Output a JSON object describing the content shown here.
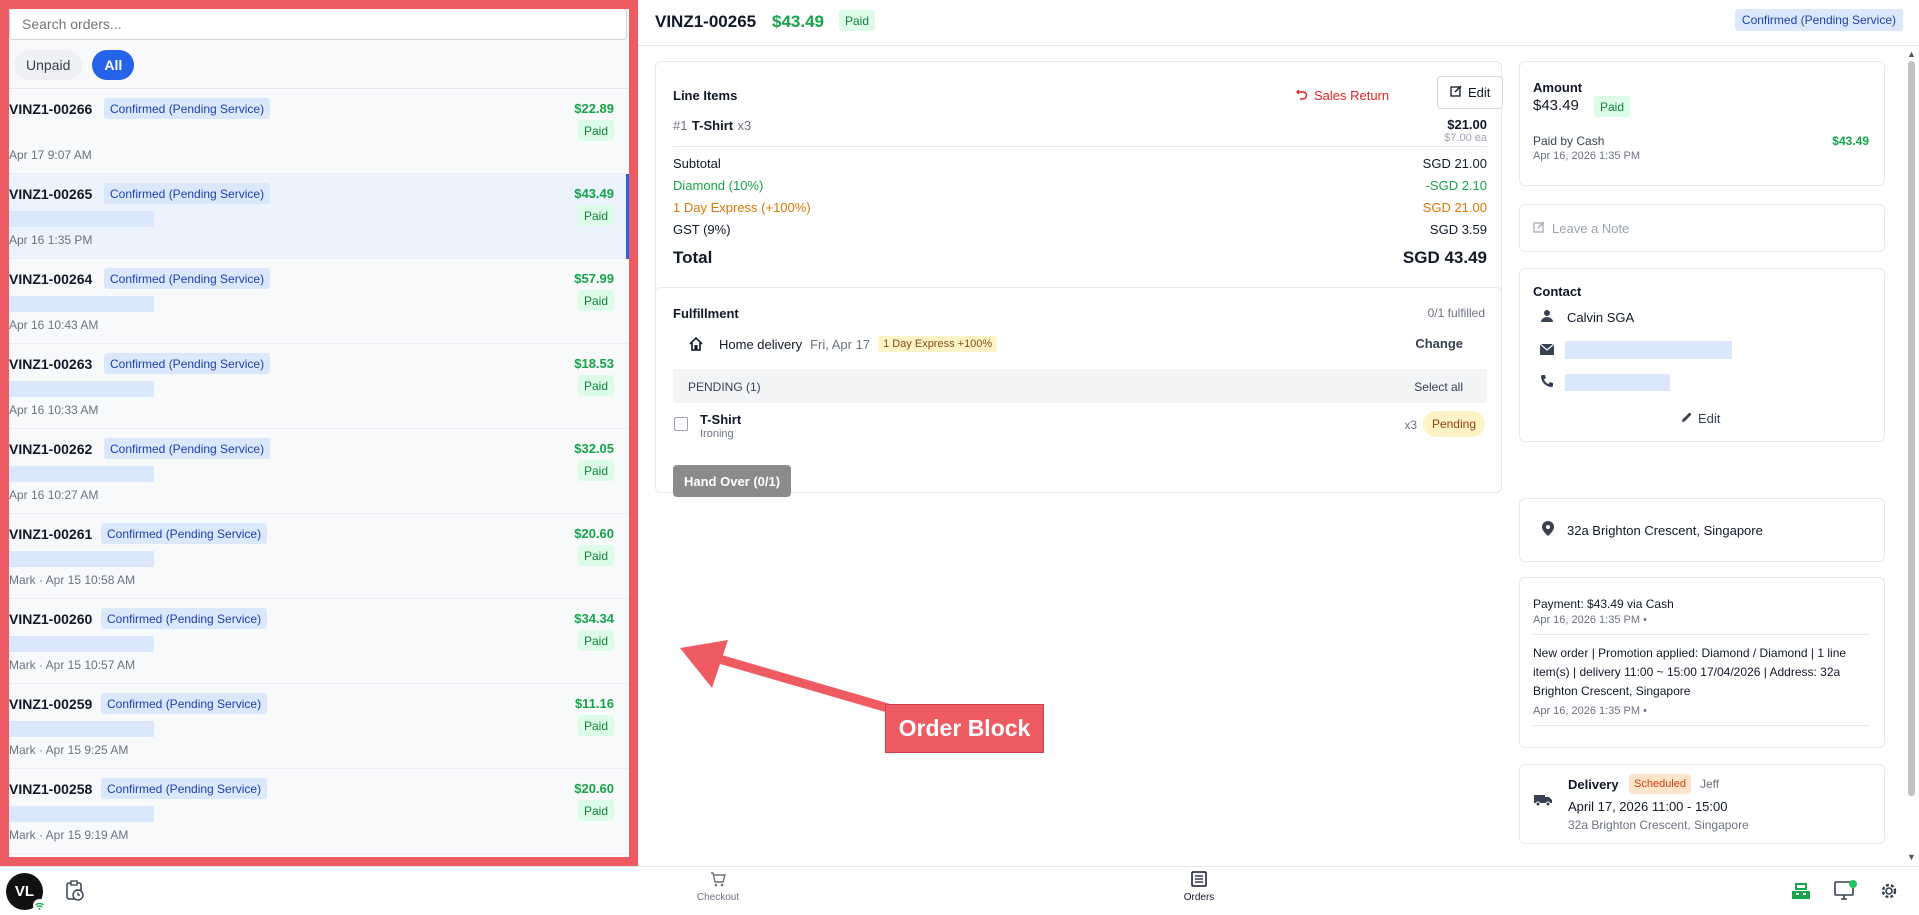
{
  "search": {
    "placeholder": "Search orders..."
  },
  "filters": {
    "unpaid": "Unpaid",
    "all": "All"
  },
  "orders": [
    {
      "id": "VINZ1-00266",
      "status": "Confirmed (Pending Service)",
      "amount": "$22.89",
      "paid": "Paid",
      "date": "Apr 17 9:07 AM",
      "has_customer": false
    },
    {
      "id": "VINZ1-00265",
      "status": "Confirmed (Pending Service)",
      "amount": "$43.49",
      "paid": "Paid",
      "date": "Apr 16 1:35 PM",
      "has_customer": true,
      "selected": true
    },
    {
      "id": "VINZ1-00264",
      "status": "Confirmed (Pending Service)",
      "amount": "$57.99",
      "paid": "Paid",
      "date": "Apr 16 10:43 AM",
      "has_customer": true
    },
    {
      "id": "VINZ1-00263",
      "status": "Confirmed (Pending Service)",
      "amount": "$18.53",
      "paid": "Paid",
      "date": "Apr 16 10:33 AM",
      "has_customer": true
    },
    {
      "id": "VINZ1-00262",
      "status": "Confirmed (Pending Service)",
      "amount": "$32.05",
      "paid": "Paid",
      "date": "Apr 16 10:27 AM",
      "has_customer": true
    },
    {
      "id": "VINZ1-00261",
      "status": "Confirmed (Pending Service)",
      "amount": "$20.60",
      "paid": "Paid",
      "date": "Mark · Apr 15 10:58 AM",
      "has_customer": true
    },
    {
      "id": "VINZ1-00260",
      "status": "Confirmed (Pending Service)",
      "amount": "$34.34",
      "paid": "Paid",
      "date": "Mark · Apr 15 10:57 AM",
      "has_customer": true
    },
    {
      "id": "VINZ1-00259",
      "status": "Confirmed (Pending Service)",
      "amount": "$11.16",
      "paid": "Paid",
      "date": "Mark · Apr 15 9:25 AM",
      "has_customer": true
    },
    {
      "id": "VINZ1-00258",
      "status": "Confirmed (Pending Service)",
      "amount": "$20.60",
      "paid": "Paid",
      "date": "Mark · Apr 15 9:19 AM",
      "has_customer": true
    }
  ],
  "header": {
    "order_id": "VINZ1-00265",
    "amount": "$43.49",
    "paid": "Paid",
    "status": "Confirmed (Pending Service)"
  },
  "line_items": {
    "title": "Line Items",
    "sales_return": "Sales Return",
    "edit": "Edit",
    "item": {
      "num": "#1",
      "name": "T-Shirt",
      "qty": "x3",
      "price": "$21.00",
      "each": "$7.00 ea"
    },
    "subtotal_label": "Subtotal",
    "subtotal": "SGD 21.00",
    "discount_label": "Diamond (10%)",
    "discount": "-SGD 2.10",
    "express_label": "1 Day Express (+100%)",
    "express": "SGD 21.00",
    "gst_label": "GST (9%)",
    "gst": "SGD 3.59",
    "total_label": "Total",
    "total": "SGD 43.49"
  },
  "fulfillment": {
    "title": "Fulfillment",
    "count": "0/1 fulfilled",
    "type": "Home delivery",
    "date": "Fri, Apr 17",
    "express": "1 Day Express +100%",
    "change": "Change",
    "pending_label": "PENDING (1)",
    "select_all": "Select all",
    "item_name": "T-Shirt",
    "item_service": "Ironing",
    "item_qty": "x3",
    "item_status": "Pending",
    "handover": "Hand Over (0/1)"
  },
  "amount_card": {
    "title": "Amount",
    "amount": "$43.49",
    "paid": "Paid",
    "method": "Paid by Cash",
    "method_amount": "$43.49",
    "date": "Apr 16, 2026 1:35 PM"
  },
  "note": {
    "placeholder": "Leave a Note"
  },
  "contact": {
    "title": "Contact",
    "name": "Calvin SGA",
    "edit": "Edit"
  },
  "address": {
    "text": "32a Brighton Crescent, Singapore"
  },
  "activity": {
    "payment": "Payment: $43.49 via Cash",
    "payment_date": "Apr 16, 2026 1:35 PM •",
    "new_order": "New order | Promotion applied: Diamond / Diamond | 1 line item(s) | delivery 11:00 ~ 15:00 17/04/2026 | Address: 32a Brighton Crescent, Singapore",
    "new_order_date": "Apr 16, 2026 1:35 PM •"
  },
  "delivery": {
    "title": "Delivery",
    "status": "Scheduled",
    "driver": "Jeff",
    "window": "April 17, 2026 11:00 - 15:00",
    "address": "32a Brighton Crescent, Singapore"
  },
  "annotation": {
    "label": "Order Block"
  },
  "bottom_nav": {
    "avatar": "VL",
    "checkout": "Checkout",
    "orders": "Orders"
  },
  "colors": {
    "accent": "#2563eb",
    "paid_green": "#16a34a",
    "annotation_red": "#ef5b63",
    "warning": "#d97706"
  }
}
